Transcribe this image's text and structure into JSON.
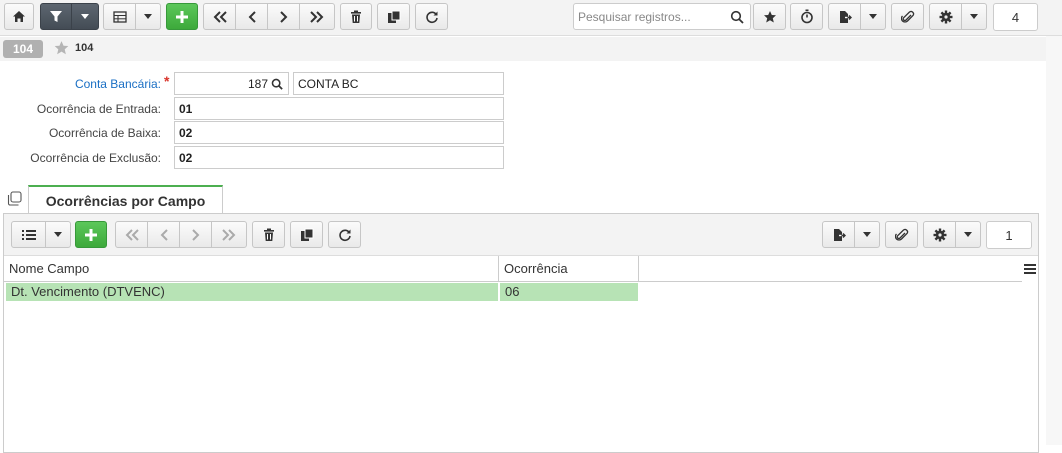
{
  "toolbar": {
    "search_placeholder": "Pesquisar registros...",
    "record_count": "4"
  },
  "record": {
    "badge": "104",
    "number": "104"
  },
  "form": {
    "conta_bancaria_label": "Conta Bancária:",
    "conta_bancaria_code": "187",
    "conta_bancaria_name": "CONTA BC",
    "ocorrencia_entrada_label": "Ocorrência de Entrada:",
    "ocorrencia_entrada_value": "01",
    "ocorrencia_baixa_label": "Ocorrência de Baixa:",
    "ocorrencia_baixa_value": "02",
    "ocorrencia_exclusao_label": "Ocorrência de Exclusão:",
    "ocorrencia_exclusao_value": "02",
    "required_mark": "*"
  },
  "tab": {
    "label": "Ocorrências por Campo"
  },
  "subgrid": {
    "record_count": "1",
    "columns": [
      "Nome Campo",
      "Ocorrência"
    ],
    "rows": [
      [
        "Dt. Vencimento (DTVENC)",
        "06"
      ]
    ]
  },
  "colors": {
    "accent_green": "#3da93b",
    "row_selected": "#b7e3b5",
    "link_blue": "#1a6fc4",
    "required_red": "#d9342b"
  }
}
